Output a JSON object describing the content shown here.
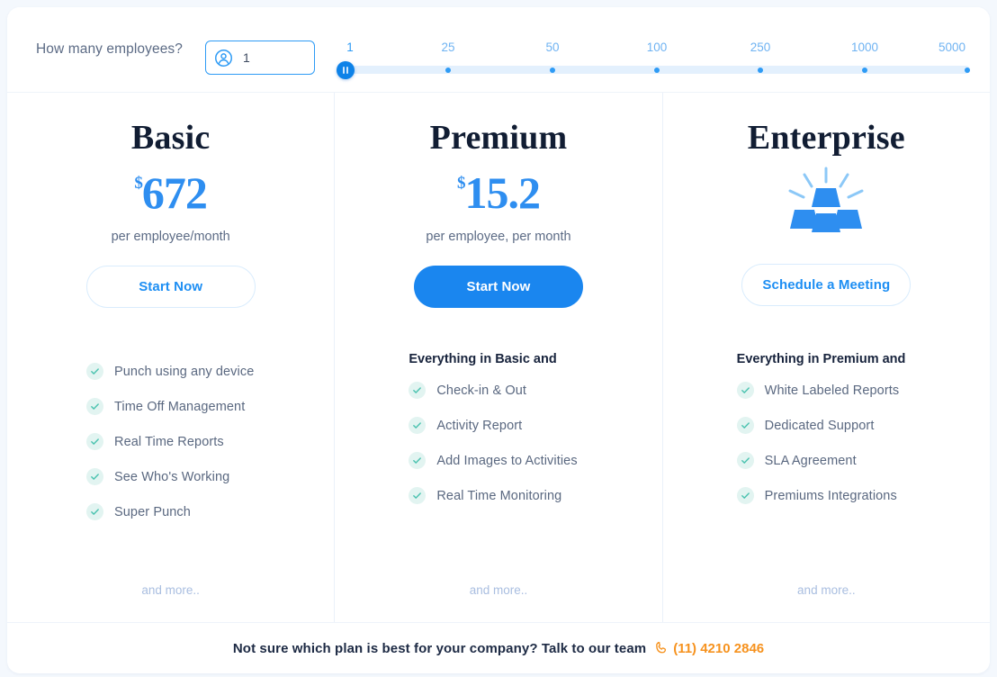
{
  "topbar": {
    "question_label": "How many employees?",
    "employee_input_value": "1",
    "employee_icon": "person-circle-icon",
    "slider": {
      "ticks": [
        "1",
        "25",
        "50",
        "100",
        "250",
        "1000",
        "5000"
      ],
      "selected_value": "1",
      "handle_icon": "drag-handle-icon"
    }
  },
  "plans": [
    {
      "name": "Basic",
      "currency": "$",
      "price": "672",
      "price_note": "per employee/month",
      "cta_label": "Start Now",
      "cta_style": "outline",
      "features_heading": "",
      "features": [
        "Punch using any device",
        "Time Off Management",
        "Real Time Reports",
        "See Who's Working",
        "Super Punch"
      ],
      "and_more": "and more.."
    },
    {
      "name": "Premium",
      "currency": "$",
      "price": "15.2",
      "price_note": "per employee, per month",
      "cta_label": "Start Now",
      "cta_style": "filled",
      "features_heading": "Everything in Basic and",
      "features": [
        "Check-in & Out",
        "Activity Report",
        "Add Images to Activities",
        "Real Time Monitoring"
      ],
      "and_more": "and more.."
    },
    {
      "name": "Enterprise",
      "icon": "gold-bars-icon",
      "cta_label": "Schedule a Meeting",
      "cta_style": "outline",
      "features_heading": "Everything in Premium and",
      "features": [
        "White Labeled Reports",
        "Dedicated Support",
        "SLA Agreement",
        "Premiums Integrations"
      ],
      "and_more": "and more.."
    }
  ],
  "footer": {
    "text": "Not sure which plan is best for your company? Talk to our team",
    "phone": "(11) 4210 2846",
    "phone_icon": "phone-icon"
  },
  "colors": {
    "accent_blue": "#1a86ef",
    "light_blue": "#2e9bf5",
    "price_blue": "#2e8ef0",
    "check_teal": "#4cc3b0",
    "phone_orange": "#f6921e",
    "heading_dark": "#111d33",
    "page_bg": "#f4f8fd"
  }
}
